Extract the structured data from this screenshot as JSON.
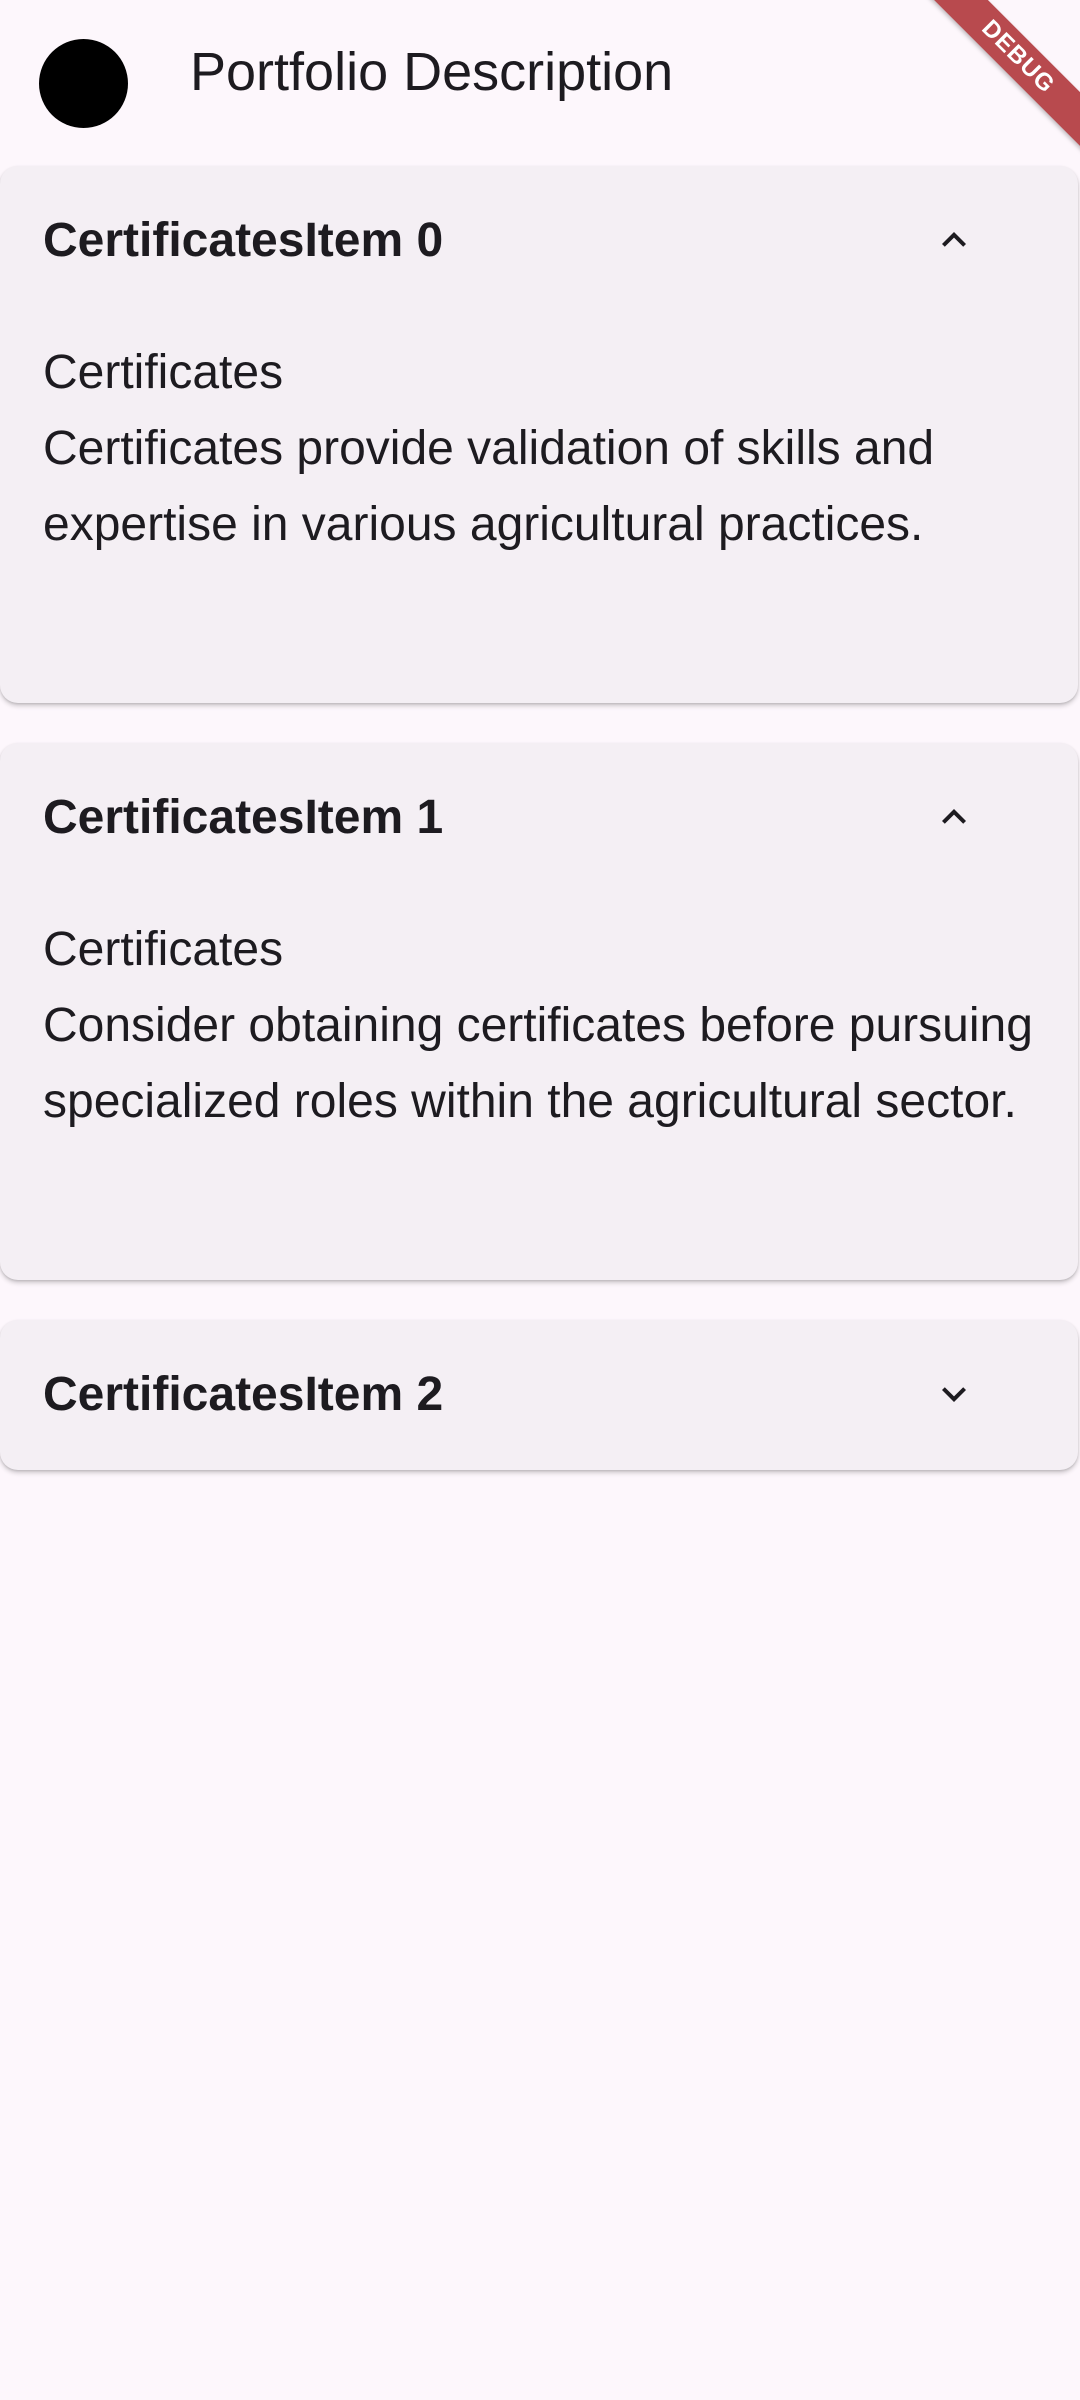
{
  "app_bar": {
    "avatar_icon": "black-circle",
    "title": "Portfolio Description"
  },
  "debug_banner": "DEBUG",
  "panels": [
    {
      "title": "CertificatesItem 0",
      "expanded": true,
      "chevron": "chevron-up-icon",
      "heading": "Certificates",
      "description": "Certificates provide validation of skills and expertise in various agricultural practices."
    },
    {
      "title": "CertificatesItem 1",
      "expanded": true,
      "chevron": "chevron-up-icon",
      "heading": "Certificates",
      "description": "Consider obtaining certificates before pursuing specialized roles within the agricultural sector."
    },
    {
      "title": "CertificatesItem 2",
      "expanded": false,
      "chevron": "chevron-down-icon"
    }
  ],
  "colors": {
    "background": "#fdf7fc",
    "panel": "#f4eff4",
    "text": "#1d1b20",
    "debug": "#b84a4e"
  }
}
